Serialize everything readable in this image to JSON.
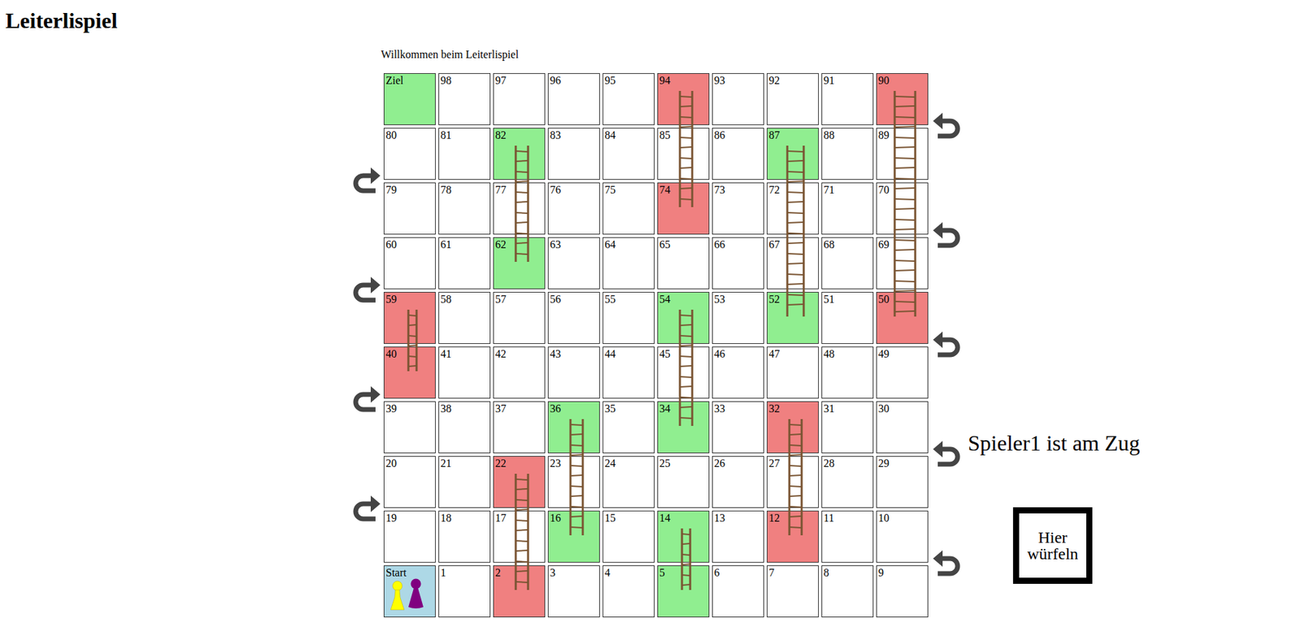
{
  "page": {
    "title": "Leiterlispiel",
    "welcome": "Willkommen beim Leiterlispiel"
  },
  "board": {
    "cells": [
      {
        "label": "Ziel",
        "color": "#90ee90"
      },
      {
        "label": "98",
        "color": "#ffffff"
      },
      {
        "label": "97",
        "color": "#ffffff"
      },
      {
        "label": "96",
        "color": "#ffffff"
      },
      {
        "label": "95",
        "color": "#ffffff"
      },
      {
        "label": "94",
        "color": "#f08080"
      },
      {
        "label": "93",
        "color": "#ffffff"
      },
      {
        "label": "92",
        "color": "#ffffff"
      },
      {
        "label": "91",
        "color": "#ffffff"
      },
      {
        "label": "90",
        "color": "#f08080"
      },
      {
        "label": "80",
        "color": "#ffffff"
      },
      {
        "label": "81",
        "color": "#ffffff"
      },
      {
        "label": "82",
        "color": "#90ee90"
      },
      {
        "label": "83",
        "color": "#ffffff"
      },
      {
        "label": "84",
        "color": "#ffffff"
      },
      {
        "label": "85",
        "color": "#ffffff"
      },
      {
        "label": "86",
        "color": "#ffffff"
      },
      {
        "label": "87",
        "color": "#90ee90"
      },
      {
        "label": "88",
        "color": "#ffffff"
      },
      {
        "label": "89",
        "color": "#ffffff"
      },
      {
        "label": "79",
        "color": "#ffffff"
      },
      {
        "label": "78",
        "color": "#ffffff"
      },
      {
        "label": "77",
        "color": "#ffffff"
      },
      {
        "label": "76",
        "color": "#ffffff"
      },
      {
        "label": "75",
        "color": "#ffffff"
      },
      {
        "label": "74",
        "color": "#f08080"
      },
      {
        "label": "73",
        "color": "#ffffff"
      },
      {
        "label": "72",
        "color": "#ffffff"
      },
      {
        "label": "71",
        "color": "#ffffff"
      },
      {
        "label": "70",
        "color": "#ffffff"
      },
      {
        "label": "60",
        "color": "#ffffff"
      },
      {
        "label": "61",
        "color": "#ffffff"
      },
      {
        "label": "62",
        "color": "#90ee90"
      },
      {
        "label": "63",
        "color": "#ffffff"
      },
      {
        "label": "64",
        "color": "#ffffff"
      },
      {
        "label": "65",
        "color": "#ffffff"
      },
      {
        "label": "66",
        "color": "#ffffff"
      },
      {
        "label": "67",
        "color": "#ffffff"
      },
      {
        "label": "68",
        "color": "#ffffff"
      },
      {
        "label": "69",
        "color": "#ffffff"
      },
      {
        "label": "59",
        "color": "#f08080"
      },
      {
        "label": "58",
        "color": "#ffffff"
      },
      {
        "label": "57",
        "color": "#ffffff"
      },
      {
        "label": "56",
        "color": "#ffffff"
      },
      {
        "label": "55",
        "color": "#ffffff"
      },
      {
        "label": "54",
        "color": "#90ee90"
      },
      {
        "label": "53",
        "color": "#ffffff"
      },
      {
        "label": "52",
        "color": "#90ee90"
      },
      {
        "label": "51",
        "color": "#ffffff"
      },
      {
        "label": "50",
        "color": "#f08080"
      },
      {
        "label": "40",
        "color": "#f08080"
      },
      {
        "label": "41",
        "color": "#ffffff"
      },
      {
        "label": "42",
        "color": "#ffffff"
      },
      {
        "label": "43",
        "color": "#ffffff"
      },
      {
        "label": "44",
        "color": "#ffffff"
      },
      {
        "label": "45",
        "color": "#ffffff"
      },
      {
        "label": "46",
        "color": "#ffffff"
      },
      {
        "label": "47",
        "color": "#ffffff"
      },
      {
        "label": "48",
        "color": "#ffffff"
      },
      {
        "label": "49",
        "color": "#ffffff"
      },
      {
        "label": "39",
        "color": "#ffffff"
      },
      {
        "label": "38",
        "color": "#ffffff"
      },
      {
        "label": "37",
        "color": "#ffffff"
      },
      {
        "label": "36",
        "color": "#90ee90"
      },
      {
        "label": "35",
        "color": "#ffffff"
      },
      {
        "label": "34",
        "color": "#90ee90"
      },
      {
        "label": "33",
        "color": "#ffffff"
      },
      {
        "label": "32",
        "color": "#f08080"
      },
      {
        "label": "31",
        "color": "#ffffff"
      },
      {
        "label": "30",
        "color": "#ffffff"
      },
      {
        "label": "20",
        "color": "#ffffff"
      },
      {
        "label": "21",
        "color": "#ffffff"
      },
      {
        "label": "22",
        "color": "#f08080"
      },
      {
        "label": "23",
        "color": "#ffffff"
      },
      {
        "label": "24",
        "color": "#ffffff"
      },
      {
        "label": "25",
        "color": "#ffffff"
      },
      {
        "label": "26",
        "color": "#ffffff"
      },
      {
        "label": "27",
        "color": "#ffffff"
      },
      {
        "label": "28",
        "color": "#ffffff"
      },
      {
        "label": "29",
        "color": "#ffffff"
      },
      {
        "label": "19",
        "color": "#ffffff"
      },
      {
        "label": "18",
        "color": "#ffffff"
      },
      {
        "label": "17",
        "color": "#ffffff"
      },
      {
        "label": "16",
        "color": "#90ee90"
      },
      {
        "label": "15",
        "color": "#ffffff"
      },
      {
        "label": "14",
        "color": "#90ee90"
      },
      {
        "label": "13",
        "color": "#ffffff"
      },
      {
        "label": "12",
        "color": "#f08080"
      },
      {
        "label": "11",
        "color": "#ffffff"
      },
      {
        "label": "10",
        "color": "#ffffff"
      },
      {
        "label": "Start",
        "color": "#add8e6"
      },
      {
        "label": "1",
        "color": "#ffffff"
      },
      {
        "label": "2",
        "color": "#f08080"
      },
      {
        "label": "3",
        "color": "#ffffff"
      },
      {
        "label": "4",
        "color": "#ffffff"
      },
      {
        "label": "5",
        "color": "#90ee90"
      },
      {
        "label": "6",
        "color": "#ffffff"
      },
      {
        "label": "7",
        "color": "#ffffff"
      },
      {
        "label": "8",
        "color": "#ffffff"
      },
      {
        "label": "9",
        "color": "#ffffff"
      }
    ],
    "ladders": [
      {
        "from": "94",
        "to": "74"
      },
      {
        "from": "82",
        "to": "62"
      },
      {
        "from": "87",
        "to": "52"
      },
      {
        "from": "90",
        "to": "50"
      },
      {
        "from": "59",
        "to": "40"
      },
      {
        "from": "54",
        "to": "34"
      },
      {
        "from": "36",
        "to": "16"
      },
      {
        "from": "32",
        "to": "12"
      },
      {
        "from": "22",
        "to": "2"
      },
      {
        "from": "14",
        "to": "5"
      }
    ],
    "pawns": [
      {
        "color": "#ffff00",
        "cell": "Start"
      },
      {
        "color": "#800080",
        "cell": "Start"
      }
    ]
  },
  "status": "Spieler1 ist am Zug",
  "buttons": [
    "Hier würfeln"
  ]
}
